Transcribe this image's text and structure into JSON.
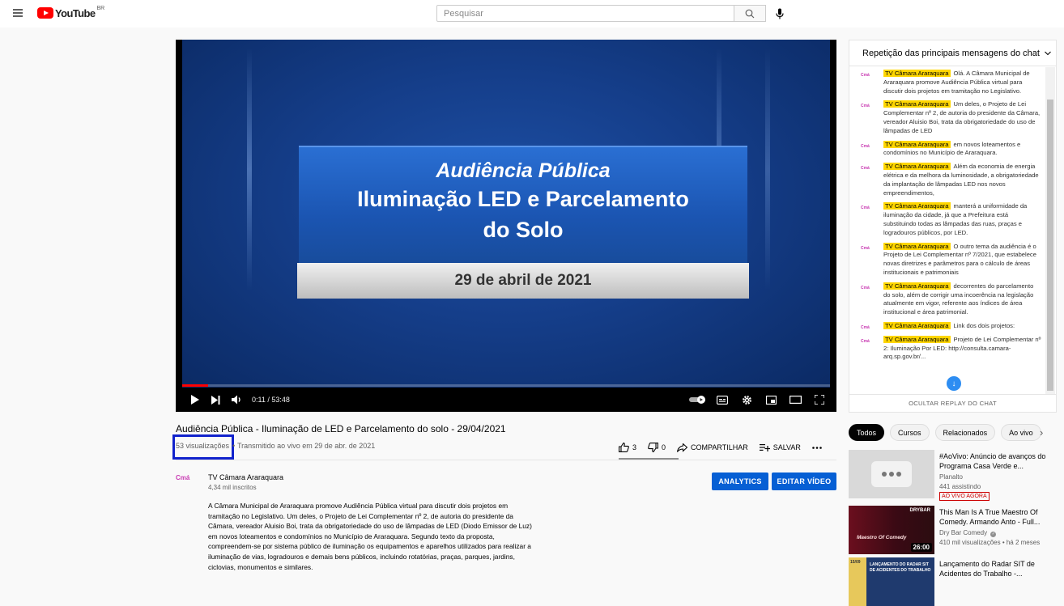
{
  "header": {
    "logo_text": "YouTube",
    "country": "BR",
    "search_placeholder": "Pesquisar"
  },
  "player": {
    "slide_line1": "Audiência Pública",
    "slide_line2": "Iluminação LED e Parcelamento",
    "slide_line3": "do Solo",
    "slide_date": "29 de abril de 2021",
    "time": "0:11 / 53:48",
    "progress": 0.0034
  },
  "video": {
    "title": "Audiência Pública - Iluminação de LED e Parcelamento do solo - 29/04/2021",
    "views": "53 visualizações",
    "dot": "•",
    "streamed": "Transmitido ao vivo em 29 de abr. de 2021",
    "likes": "3",
    "dislikes": "0",
    "share": "COMPARTILHAR",
    "save": "SALVAR"
  },
  "channel": {
    "avatar_text": "Cmá",
    "name": "TV Câmara Araraquara",
    "subs": "4,34 mil inscritos",
    "analytics": "ANALYTICS",
    "edit": "EDITAR VÍDEO",
    "description": "A Câmara Municipal de Araraquara promove Audiência Pública virtual para discutir dois projetos em tramitação no Legislativo. Um deles, o Projeto de Lei Complementar nº 2, de autoria do presidente da Câmara, vereador Aluisio Boi, trata da obrigatoriedade do uso de lâmpadas de LED (Diodo Emissor de Luz) em novos loteamentos e condomínios no Município de Araraquara. Segundo texto da proposta, compreendem-se por sistema público de iluminação os equipamentos e aparelhos utilizados para realizar a iluminação de vias, logradouros e demais bens públicos, incluindo rotatórias, praças, parques, jardins, ciclovias, monumentos e similares."
  },
  "chat": {
    "header": "Repetição das principais mensagens do chat",
    "author": "TV Câmara Araraquara",
    "avatar_text": "Cmá",
    "footer": "OCULTAR REPLAY DO CHAT",
    "messages": [
      "Olá. A Câmara Municipal de Araraquara promove Audiência Pública virtual para discutir dois projetos em tramitação no Legislativo.",
      "Um deles, o Projeto de Lei Complementar nº 2, de autoria do presidente da Câmara, vereador Aluisio Boi, trata da obrigatoriedade do uso de lâmpadas de LED",
      "em novos loteamentos e condomínios no Município de Araraquara.",
      "Além da economia de energia elétrica e da melhora da luminosidade, a obrigatoriedade da implantação de lâmpadas LED nos novos empreendimentos,",
      "manterá a uniformidade da iluminação da cidade, já que a Prefeitura está substituindo todas as lâmpadas das ruas, praças e logradouros públicos, por LED.",
      "O outro tema da audiência é o Projeto de Lei Complementar nº 7/2021, que estabelece novas diretrizes e parâmetros para o cálculo de áreas institucionais e patrimoniais",
      "decorrentes do parcelamento do solo, além de corrigir uma incoerência na legislação atualmente em vigor, referente aos índices de área institucional e área patrimonial.",
      "Link dos dois projetos:",
      "Projeto de Lei Complementar nº 2: Iluminação Por LED: http://consulta.camara-arq.sp.gov.br/..."
    ]
  },
  "chips": [
    "Todos",
    "Cursos",
    "Relacionados",
    "Ao vivo"
  ],
  "recommendations": [
    {
      "title": "#AoVivo: Anúncio de avanços do Programa Casa Verde e...",
      "channel": "Planalto",
      "meta": "441 assistindo",
      "badge": "AO VIVO AGORA"
    },
    {
      "title": "This Man Is A True Maestro Of Comedy. Armando Anto - Full...",
      "channel": "Dry Bar Comedy",
      "meta": "410 mil visualizações • há 2 meses",
      "duration": "26:00",
      "thumb_text1": "DRYBAR",
      "thumb_text2": "Maestro Of Comedy"
    },
    {
      "title": "Lançamento do Radar SIT de Acidentes do Trabalho -...",
      "thumb_text1": "15/09",
      "thumb_text2": "LANÇAMENTO DO RADAR SIT DE ACIDENTES DO TRABALHO"
    }
  ],
  "colors": {
    "accent_blue": "#065fd4",
    "youtube_red": "#ff0000",
    "chat_tag": "#ffd600",
    "annotation_box": "#1122cc"
  }
}
